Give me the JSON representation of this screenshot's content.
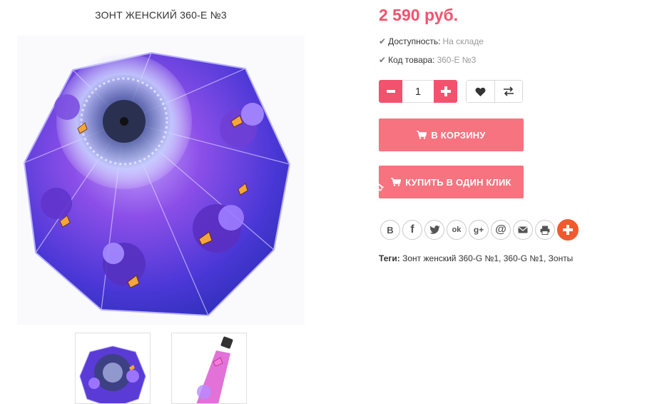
{
  "product": {
    "title": "ЗОНТ ЖЕНСКИЙ 360-Е №3",
    "price": "2 590 руб.",
    "availability_label": "Доступность:",
    "availability_value": "На складе",
    "code_label": "Код товара:",
    "code_value": "360-Е №3",
    "quantity": "1"
  },
  "icons": {
    "check": "check-icon",
    "minus": "minus-icon",
    "plus": "plus-icon",
    "wishlist": "heart-icon",
    "compare": "compare-arrows-icon",
    "cart": "cart-icon"
  },
  "buttons": {
    "add_to_cart": "В КОРЗИНУ",
    "one_click": "КУПИТЬ В ОДИН КЛИК",
    "one_click_mark": "ru"
  },
  "share": {
    "vk": "В",
    "fb": "f",
    "ok": "ok",
    "gplus": "g+",
    "mail": "@"
  },
  "tags": {
    "label": "Теги:",
    "items": [
      "Зонт женский 360-G №1",
      "360-G №1",
      "Зонты"
    ]
  },
  "colors": {
    "accent": "#f2526d",
    "button": "#f6737f",
    "share_plus": "#ef5a2f"
  }
}
